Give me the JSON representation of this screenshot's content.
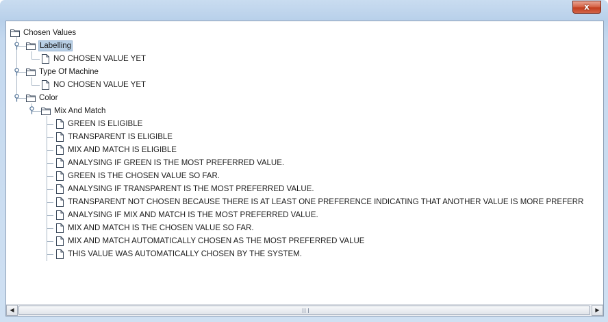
{
  "window": {
    "close_label": "x"
  },
  "tree": {
    "root": "Chosen Values",
    "labelling": {
      "label": "Labelling",
      "child": "NO CHOSEN VALUE YET"
    },
    "type_of_machine": {
      "label": "Type Of Machine",
      "child": "NO CHOSEN VALUE YET"
    },
    "color": {
      "label": "Color",
      "mix_and_match": {
        "label": "Mix And Match",
        "items": [
          "GREEN IS ELIGIBLE",
          "TRANSPARENT IS ELIGIBLE",
          "MIX AND MATCH IS ELIGIBLE",
          "ANALYSING IF GREEN IS THE MOST PREFERRED VALUE.",
          "GREEN IS THE CHOSEN VALUE SO FAR.",
          "ANALYSING IF TRANSPARENT IS THE MOST PREFERRED VALUE.",
          "TRANSPARENT NOT CHOSEN BECAUSE THERE IS AT LEAST ONE PREFERENCE INDICATING THAT ANOTHER VALUE IS MORE PREFERR",
          "ANALYSING IF MIX AND MATCH IS THE MOST PREFERRED VALUE.",
          "MIX AND MATCH IS THE CHOSEN VALUE SO FAR.",
          "MIX AND MATCH AUTOMATICALLY CHOSEN AS THE MOST PREFERRED VALUE",
          "THIS VALUE WAS AUTOMATICALLY CHOSEN BY THE SYSTEM."
        ]
      }
    }
  },
  "scrollbar": {
    "left_arrow": "◀",
    "right_arrow": "▶"
  },
  "icons": {
    "folder": "folder-icon",
    "document": "document-icon",
    "expand_toggle": "expanded-toggle-icon"
  }
}
